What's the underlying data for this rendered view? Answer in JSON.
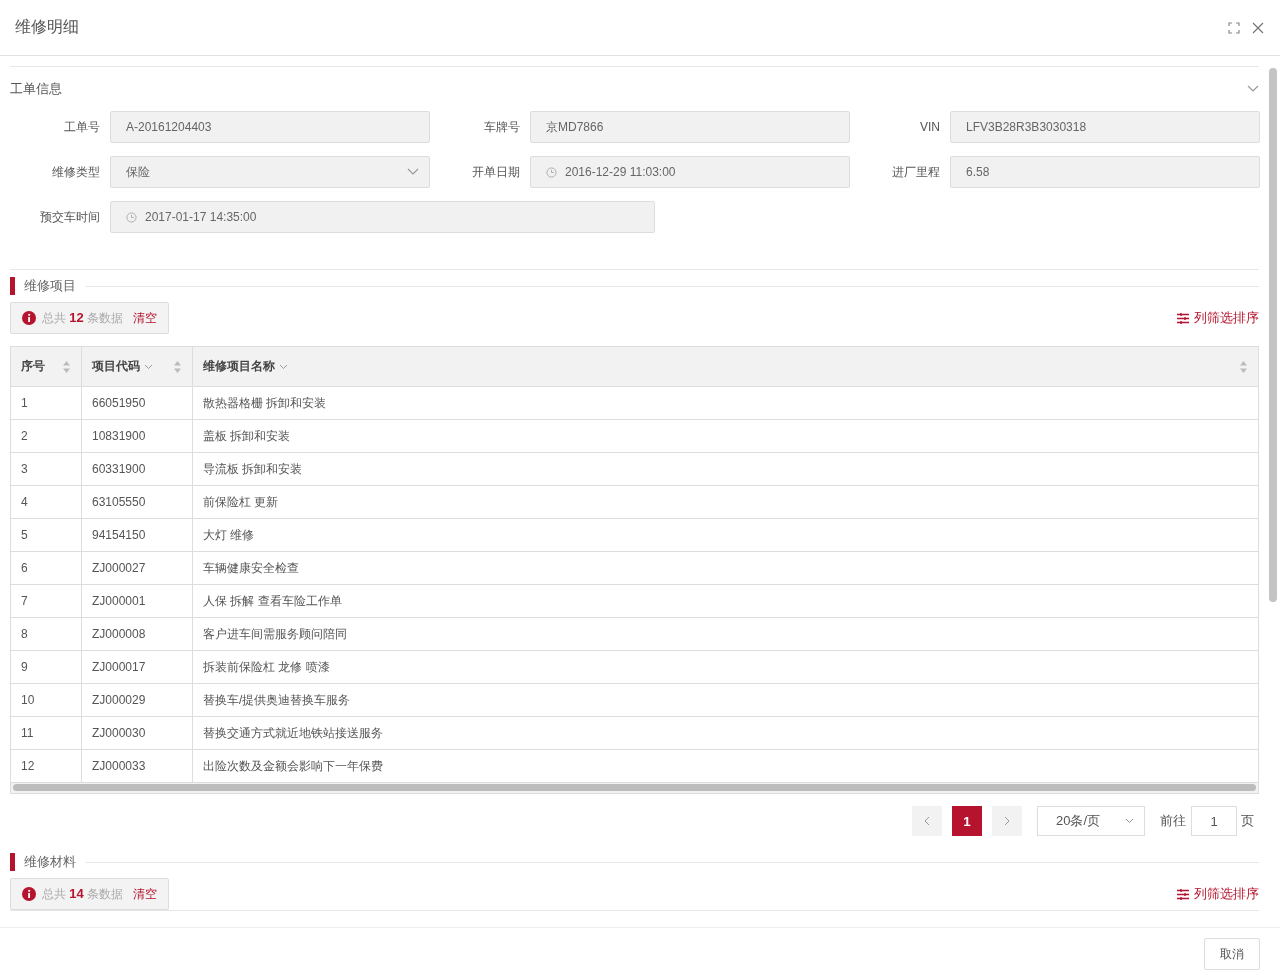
{
  "dialog": {
    "title": "维修明细"
  },
  "work_order": {
    "title": "工单信息",
    "expanded": true,
    "fields": [
      {
        "label": "工单号",
        "kind": "text",
        "value": "A-20161204403"
      },
      {
        "label": "车牌号",
        "kind": "text",
        "value": "京MD7866"
      },
      {
        "label": "VIN",
        "kind": "text",
        "value": "LFV3B28R3B3030318"
      },
      {
        "label": "维修类型",
        "kind": "select",
        "value": "保险"
      },
      {
        "label": "开单日期",
        "kind": "date",
        "value": "2016-12-29 11:03:00"
      },
      {
        "label": "进厂里程",
        "kind": "text",
        "value": "6.58"
      },
      {
        "label": "预交车时间",
        "kind": "date",
        "value": "2017-01-17 14:35:00",
        "wide": true
      }
    ]
  },
  "repair_items": {
    "title": "维修项目",
    "summary": "总共 **12** 条数据",
    "clear": "清空",
    "column_settings": "列筛选排序",
    "columns": [
      {
        "label": "序号",
        "filter": false,
        "sortable": true
      },
      {
        "label": "项目代码",
        "filter": true,
        "sortable": true
      },
      {
        "label": "维修项目名称",
        "filter": true,
        "sortable": true
      }
    ],
    "rows": [
      [
        "1",
        "66051950",
        "散热器格栅 拆卸和安装"
      ],
      [
        "2",
        "10831900",
        "盖板 拆卸和安装"
      ],
      [
        "3",
        "60331900",
        "导流板 拆卸和安装"
      ],
      [
        "4",
        "63105550",
        "前保险杠 更新"
      ],
      [
        "5",
        "94154150",
        "大灯 维修"
      ],
      [
        "6",
        "ZJ000027",
        "车辆健康安全检查"
      ],
      [
        "7",
        "ZJ000001",
        "人保 拆解 查看车险工作单"
      ],
      [
        "8",
        "ZJ000008",
        "客户进车间需服务顾问陪同"
      ],
      [
        "9",
        "ZJ000017",
        "拆装前保险杠 龙修 喷漆"
      ],
      [
        "10",
        "ZJ000029",
        "替换车/提供奥迪替换车服务"
      ],
      [
        "11",
        "ZJ000030",
        "替换交通方式就近地铁站接送服务"
      ],
      [
        "12",
        "ZJ000033",
        "出险次数及金额会影响下一年保费"
      ]
    ],
    "pagination": {
      "pages": [
        {
          "label": "1",
          "selected": true
        }
      ],
      "page_size": "20条/页",
      "goto_label": "前往",
      "goto_value": "1",
      "page_unit": "页"
    }
  },
  "repair_materials": {
    "title": "维修材料",
    "summary": "总共 **14** 条数据",
    "clear": "清空",
    "column_settings": "列筛选排序"
  },
  "footer": {
    "cancel": "取消"
  }
}
